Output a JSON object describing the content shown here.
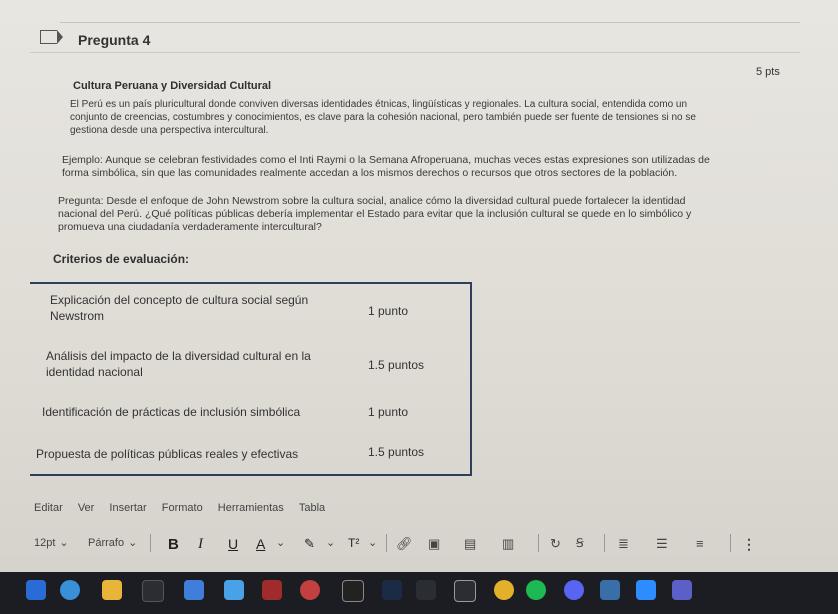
{
  "question": {
    "title": "Pregunta 4",
    "points": "5 pts",
    "subtitle": "Cultura Peruana y Diversidad Cultural"
  },
  "body": {
    "p1": [
      "El Perú es un país pluricultural donde conviven diversas identidades étnicas, lingüísticas y regionales. La cultura social, entendida como un",
      "conjunto de creencias, costumbres y conocimientos, es clave para la cohesión nacional, pero también puede ser fuente de tensiones si no se",
      "gestiona desde una perspectiva intercultural."
    ],
    "p2": [
      "Ejemplo: Aunque se celebran festividades como el Inti Raymi o la Semana Afroperuana, muchas veces estas expresiones son utilizadas de",
      "forma simbólica, sin que las comunidades realmente accedan a los mismos derechos o recursos que otros sectores de la población."
    ],
    "p3": [
      "Pregunta: Desde el enfoque de John Newstrom sobre la cultura social, analice cómo la diversidad cultural puede fortalecer la identidad",
      "nacional del Perú. ¿Qué políticas públicas debería implementar el Estado para evitar que la inclusión cultural se quede en lo simbólico y",
      "promueva una ciudadanía verdaderamente intercultural?"
    ]
  },
  "criteria": {
    "heading": "Criterios de evaluación:",
    "rows": [
      {
        "lines": [
          "Explicación del concepto de cultura social según",
          "Newstrom"
        ],
        "points": "1 punto"
      },
      {
        "lines": [
          "Análisis del impacto de la diversidad cultural en la",
          "identidad nacional"
        ],
        "points": "1.5 puntos"
      },
      {
        "lines": [
          "Identificación de prácticas de inclusión simbólica"
        ],
        "points": "1 punto"
      },
      {
        "lines": [
          "Propuesta de políticas públicas reales y efectivas"
        ],
        "points": "1.5 puntos"
      }
    ]
  },
  "editor": {
    "menu": [
      "Editar",
      "Ver",
      "Insertar",
      "Formato",
      "Herramientas",
      "Tabla"
    ],
    "font_size": "12pt",
    "paragraph": "Párrafo",
    "bold": "B",
    "italic": "I",
    "underline": "U",
    "font_color": "A",
    "superscript": "T²"
  },
  "taskbar": {
    "icons": [
      "windows-icon",
      "browser-icon",
      "files-icon",
      "store-icon",
      "app-icon",
      "photos-icon",
      "antivirus-icon",
      "autocad-icon",
      "capcut-icon",
      "steam-icon",
      "gmail-icon",
      "epic-icon",
      "chrome-icon",
      "spotify-icon",
      "discord-icon",
      "notepad-icon",
      "zoom-icon",
      "teams-icon"
    ],
    "accent": "#1c1d22"
  }
}
